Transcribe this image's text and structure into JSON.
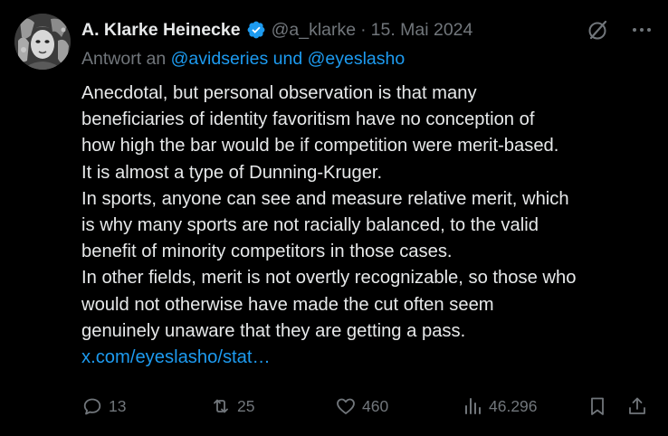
{
  "tweet": {
    "author_name": "A. Klarke Heinecke",
    "handle": "@a_klarke",
    "separator": "·",
    "date": "15. Mai 2024",
    "reply_prefix": "Antwort an",
    "reply_handles": "@avidseries und @eyeslasho",
    "text_lines": [
      "Anecdotal, but personal observation is that many",
      "beneficiaries of identity favoritism have no conception of",
      "how high the bar would be if competition were merit-based.",
      "It is almost a type of Dunning-Kruger.",
      "In sports, anyone can see and measure relative merit, which",
      "is why many sports are not racially balanced, to the valid",
      "benefit of minority competitors in those cases.",
      "In other fields, merit is not overtly recognizable, so those who",
      "would not otherwise have made the cut often seem",
      "genuinely unaware that they are getting a pass."
    ],
    "link": "x.com/eyeslasho/stat…"
  },
  "actions": {
    "replies": "13",
    "reposts": "25",
    "likes": "460",
    "views": "46.296"
  },
  "icons": {
    "verified": "verified-badge-icon",
    "grok": "grok-icon",
    "more": "more-icon",
    "reply": "reply-icon",
    "repost": "repost-icon",
    "like": "heart-icon",
    "views": "views-chart-icon",
    "bookmark": "bookmark-icon",
    "share": "share-icon"
  },
  "colors": {
    "background": "#000000",
    "text": "#e7e9ea",
    "muted": "#71767b",
    "accent": "#1d9bf0"
  }
}
